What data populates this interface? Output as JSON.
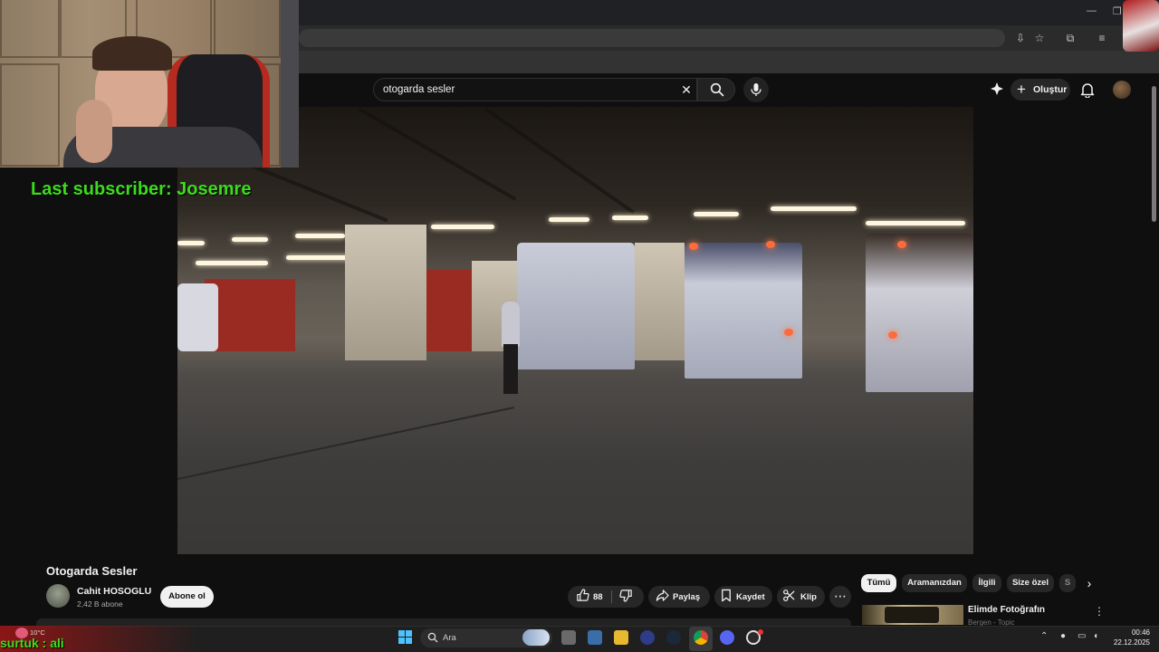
{
  "search": {
    "query": "otogarda sesler"
  },
  "header": {
    "create_label": "Oluştur"
  },
  "overlay": {
    "last_subscriber": "Last subscriber: Josemre",
    "ticker": "surtuk : ali"
  },
  "video": {
    "title": "Otogarda Sesler",
    "channel_name": "Cahit HOSOGLU",
    "subscribers": "2,42 B abone",
    "subscribe_label": "Abone ol",
    "likes": "88",
    "share_label": "Paylaş",
    "save_label": "Kaydet",
    "clip_label": "Klip"
  },
  "sidebar": {
    "chips": [
      "Tümü",
      "Aramanızdan",
      "İlgili",
      "Size özel",
      "S"
    ],
    "recommendation": {
      "title": "Elimde Fotoğrafın",
      "channel": "Bergen - Topic"
    }
  },
  "taskbar": {
    "weather_temp": "10°C",
    "search_label": "Ara",
    "time": "00:46",
    "date": "22.12.2025"
  },
  "icons": [
    "search-icon",
    "close-icon",
    "mic-icon",
    "bell-icon",
    "like-icon",
    "dislike-icon",
    "share-icon",
    "bookmark-icon",
    "scissors-icon",
    "more-icon",
    "windows-icon",
    "chrome-icon",
    "discord-icon",
    "steam-icon"
  ]
}
